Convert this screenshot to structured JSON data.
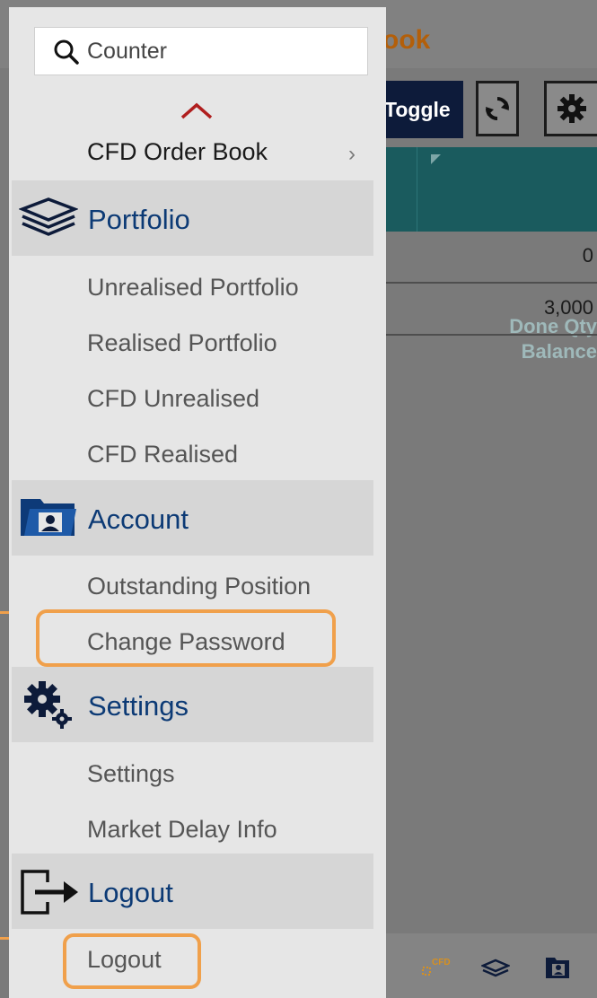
{
  "background_app": {
    "title_fragment": "ook",
    "toggle_label": "Toggle",
    "column_header_lines": [
      "Done Qty",
      "Balance"
    ],
    "rows": [
      "0",
      "3,000"
    ],
    "bottom_nav_cfd_label": "CFD"
  },
  "drawer": {
    "search": {
      "placeholder": "Counter"
    },
    "cfd_order_book": "CFD Order Book",
    "sections": {
      "portfolio": {
        "label": "Portfolio",
        "items": [
          "Unrealised Portfolio",
          "Realised Portfolio",
          "CFD Unrealised",
          "CFD Realised"
        ]
      },
      "account": {
        "label": "Account",
        "items": [
          "Outstanding Position",
          "Change Password"
        ]
      },
      "settings": {
        "label": "Settings",
        "items": [
          "Settings",
          "Market Delay Info"
        ]
      },
      "logout": {
        "label": "Logout",
        "items": [
          "Logout"
        ]
      }
    }
  },
  "colors": {
    "section_label": "#0c3a75",
    "highlight": "#f0a04b",
    "toggle_bg": "#0d1b3a",
    "header_teal": "#1a5b5e"
  }
}
